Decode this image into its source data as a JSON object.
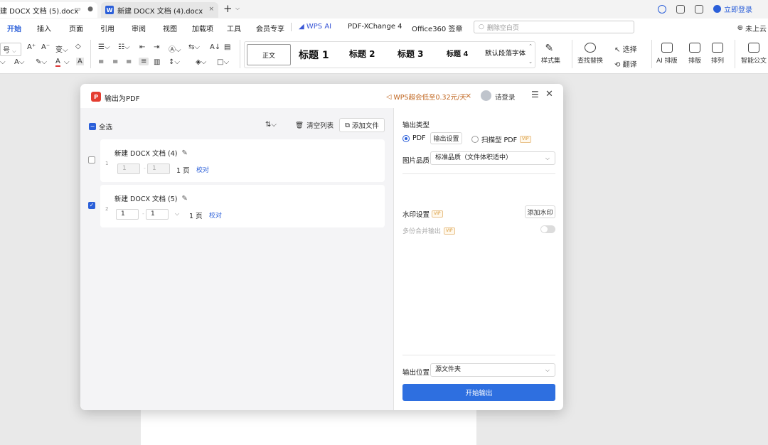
{
  "tabs": [
    {
      "label": "建 DOCX 文档 (5).docx"
    },
    {
      "label": "新建 DOCX 文档 (4).docx",
      "icon": "W"
    }
  ],
  "topbar": {
    "login": "立即登录"
  },
  "menu": {
    "items": [
      "开始",
      "插入",
      "页面",
      "引用",
      "审阅",
      "视图",
      "加载项",
      "工具",
      "会员专享",
      "WPS AI",
      "PDF-XChange 4",
      "Office360 签章"
    ],
    "search_placeholder": "删除空白页",
    "cloud": "未上云"
  },
  "ribbon": {
    "font_size": "号",
    "styles": [
      "正文",
      "标题 1",
      "标题 2",
      "标题 3",
      "标题 4",
      "默认段落字体"
    ],
    "style_set": "样式集",
    "find_replace": "查找替换",
    "select": "选择",
    "translate": "翻译",
    "ai_layout": "AI 排版",
    "layout": "排版",
    "arrange": "排列",
    "smart": "智能公文"
  },
  "dialog": {
    "title": "输出为PDF",
    "promo": "WPS超会低至0.32元/天",
    "user": "请登录",
    "select_all": "全选",
    "clear_list": "清空列表",
    "add_file": "添加文件",
    "files": [
      {
        "index": "1",
        "name": "新建 DOCX 文档 (4)",
        "from": "1",
        "to": "1",
        "pages": "1 页",
        "proof": "校对",
        "checked": false
      },
      {
        "index": "2",
        "name": "新建 DOCX 文档 (5)",
        "from": "1",
        "to": "1",
        "pages": "1 页",
        "proof": "校对",
        "checked": true
      }
    ],
    "output_type_label": "输出类型",
    "pdf_label": "PDF",
    "output_settings": "输出设置",
    "scan_pdf": "扫描型 PDF",
    "vip": "VIP",
    "image_quality_label": "图片品质",
    "image_quality_value": "标准品质（文件体积适中）",
    "watermark_label": "水印设置",
    "add_watermark": "添加水印",
    "merge_label": "多份合并输出",
    "output_location_label": "输出位置",
    "output_location_value": "源文件夹",
    "start": "开始输出"
  }
}
